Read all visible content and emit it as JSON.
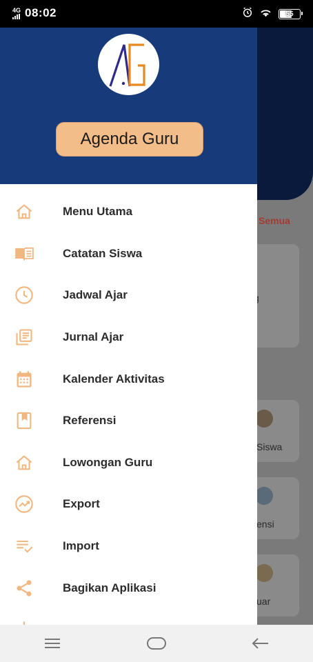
{
  "status_bar": {
    "network": "4G",
    "time": "08:02",
    "battery": "55"
  },
  "background": {
    "semua": "Semua",
    "card_texts": [
      "g",
      "Siswa",
      "ensi",
      "uar"
    ]
  },
  "drawer": {
    "app_title": "Agenda Guru",
    "logo_text": "AG",
    "accent_color": "#f3bd8a",
    "header_color": "#163a7a",
    "icon_color": "#f0b880",
    "items": [
      {
        "label": "Menu Utama",
        "icon": "home-icon"
      },
      {
        "label": "Catatan Siswa",
        "icon": "book-open-icon"
      },
      {
        "label": "Jadwal Ajar",
        "icon": "clock-icon"
      },
      {
        "label": "Jurnal Ajar",
        "icon": "library-books-icon"
      },
      {
        "label": "Kalender Aktivitas",
        "icon": "calendar-icon"
      },
      {
        "label": "Referensi",
        "icon": "bookmark-book-icon"
      },
      {
        "label": "Lowongan Guru",
        "icon": "home-icon"
      },
      {
        "label": "Export",
        "icon": "export-chart-icon"
      },
      {
        "label": "Import",
        "icon": "playlist-check-icon"
      },
      {
        "label": "Bagikan Aplikasi",
        "icon": "share-icon"
      }
    ]
  },
  "nav_bar": {
    "buttons": [
      "menu-icon",
      "home-button-icon",
      "back-icon"
    ]
  }
}
